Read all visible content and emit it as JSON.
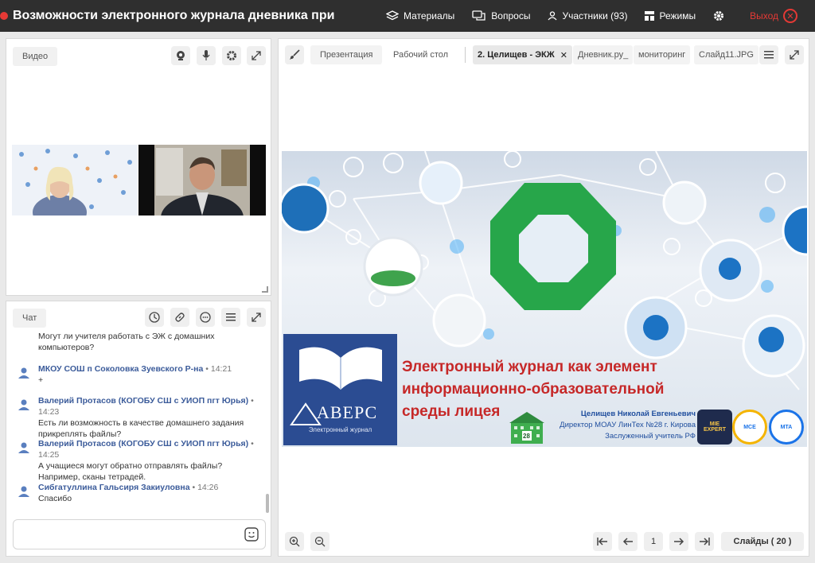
{
  "header": {
    "title": "Возможности электронного журнала дневника при",
    "nav": {
      "materials": "Материалы",
      "questions": "Вопросы",
      "participants": "Участники (93)",
      "modes": "Режимы",
      "exit": "Выход"
    }
  },
  "video": {
    "label": "Видео"
  },
  "chat": {
    "label": "Чат",
    "messages": [
      {
        "author": "",
        "time": "",
        "text": "Могут ли учителя работать с ЭЖ с домашних компьютеров?"
      },
      {
        "author": "МКОУ СОШ п Соколовка Зуевского Р-на",
        "time": "14:21",
        "text": "+"
      },
      {
        "author": "Валерий Протасов (КОГОБУ СШ с УИОП пгт Юрья)",
        "time": "14:23",
        "text": "Есть ли возможность в качестве домашнего задания прикреплять файлы?"
      },
      {
        "author": "Валерий Протасов (КОГОБУ СШ с УИОП пгт Юрья)",
        "time": "14:25",
        "text": "А учащиеся могут обратно отправлять файлы? Например, сканы тетрадей."
      },
      {
        "author": "Сибгатуллина Гальсиря Закиуловна",
        "time": "14:26",
        "text": "Спасибо"
      }
    ]
  },
  "main": {
    "tabs": {
      "presentation": "Презентация",
      "desktop": "Рабочий стол",
      "active": "2. Целищев - ЭКЖ",
      "t1": "Дневник.ру_",
      "t2": "мониторинг",
      "t3": "Слайд11.JPG"
    },
    "slide": {
      "title_line1": "Электронный журнал как элемент",
      "title_line2": "информационно-образовательной",
      "title_line3": "среды лицея",
      "author_name": "Целищев Николай Евгеньевич",
      "author_role": "Директор МОАУ ЛинТех №28 г. Кирова",
      "author_title": "Заслуженный учитель РФ",
      "logo_name": "АВЕРС",
      "logo_sub": "Электронный журнал",
      "school_number": "28",
      "badge1": "MIE EXPERT",
      "badge2": "MCE",
      "badge3": "MTA"
    },
    "pager": {
      "page": "1",
      "slides_label": "Слайды ( 20 )"
    }
  }
}
